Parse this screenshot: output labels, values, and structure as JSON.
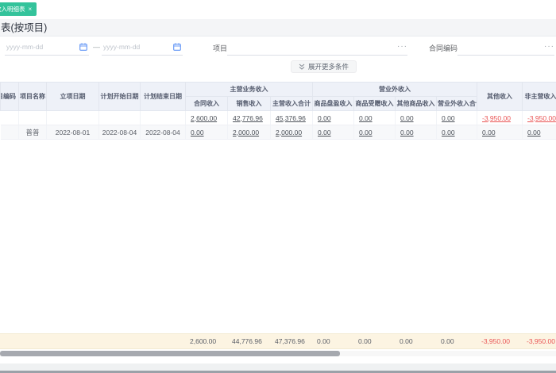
{
  "tab": {
    "label": "收入明细表",
    "close": "×"
  },
  "page": {
    "title": "表(按项目)"
  },
  "filters": {
    "date_start_placeholder": "yyyy-mm-dd",
    "date_end_placeholder": "yyyy-mm-dd",
    "separator": "—",
    "project_label": "项目",
    "project_ellipsis": "···",
    "contract_label": "合同编码",
    "contract_ellipsis": "···",
    "expand_label": "展开更多条件"
  },
  "table": {
    "header": {
      "simple": [
        "项目编码",
        "项目名称",
        "立项日期",
        "计划开始日期",
        "计划结束日期"
      ],
      "groups": [
        {
          "label": "主营业务收入",
          "children": [
            "合同收入",
            "销售收入",
            "主营收入合计"
          ]
        },
        {
          "label": "营业外收入",
          "children": [
            "商品盘盈收入",
            "商品受赠收入",
            "其他商品收入",
            "营业外收入合计"
          ]
        }
      ],
      "tail": [
        "其他收入",
        "非主营收入合计"
      ]
    },
    "rows": [
      {
        "code": "",
        "name": "",
        "founded": "",
        "plan_start": "",
        "plan_end": "",
        "values": [
          "2,600.00",
          "42,776.96",
          "45,376.96",
          "0.00",
          "0.00",
          "0.00",
          "0.00",
          "-3,950.00",
          "-3,950.00"
        ]
      },
      {
        "code": "",
        "name": "普普",
        "founded": "2022-08-01",
        "plan_start": "2022-08-04",
        "plan_end": "2022-08-04",
        "values": [
          "0.00",
          "2,000.00",
          "2,000.00",
          "0.00",
          "0.00",
          "0.00",
          "0.00",
          "0.00",
          "0.00"
        ]
      }
    ],
    "totals": [
      "2,600.00",
      "44,776.96",
      "47,376.96",
      "0.00",
      "0.00",
      "0.00",
      "0.00",
      "-3,950.00",
      "-3,950.00"
    ]
  },
  "colors": {
    "accent_green": "#34c39b",
    "negative_red": "#e95454",
    "totals_bg": "#fcf4e2",
    "calendar_icon_blue": "#6195f6"
  }
}
